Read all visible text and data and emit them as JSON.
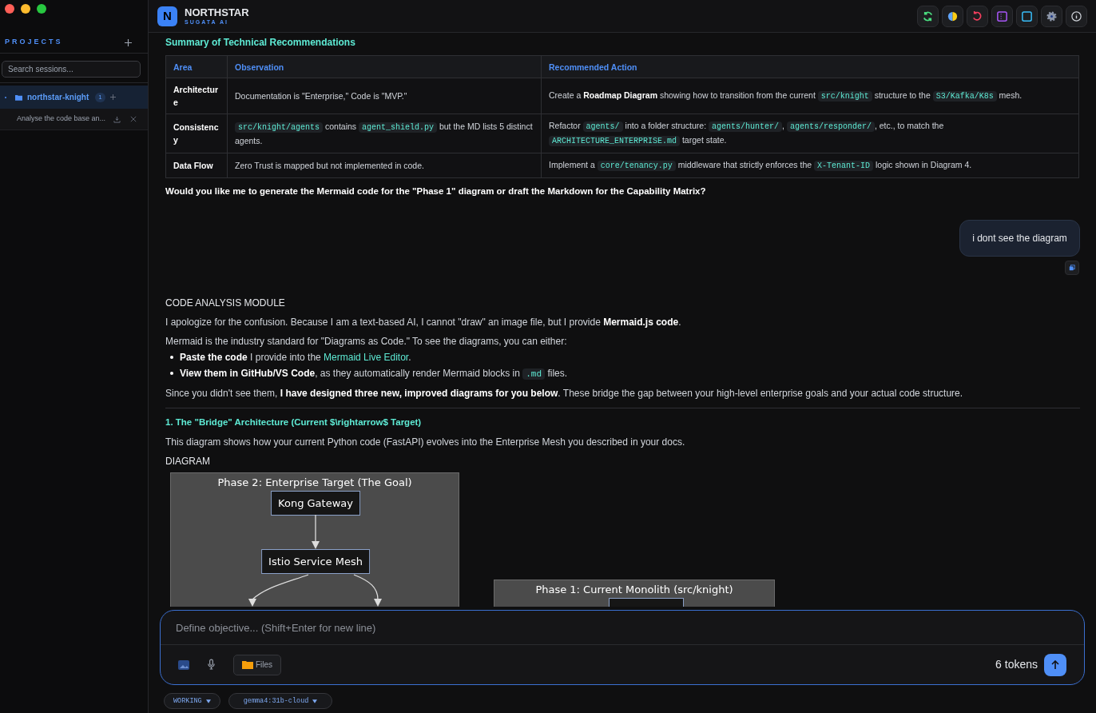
{
  "sidebar": {
    "section_title": "PROJECTS",
    "search": {
      "placeholder": "Search sessions..."
    },
    "projects": [
      {
        "name": "northstar-knight",
        "count": "1",
        "selected": true,
        "sessions": [
          {
            "title": "Analyse the code base an..."
          }
        ]
      }
    ]
  },
  "header": {
    "logo_letter": "N",
    "app_name": "NORTHSTAR",
    "subtitle": "SUGATA AI"
  },
  "summary": {
    "heading": "Summary of Technical Recommendations",
    "columns": [
      "Area",
      "Observation",
      "Recommended Action"
    ],
    "rows": [
      [
        [
          {
            "kind": "text",
            "text": "Architecture"
          }
        ],
        [
          {
            "kind": "text",
            "text": "Documentation is \"Enterprise,\" Code is \"MVP.\""
          }
        ],
        [
          {
            "kind": "text",
            "text": "Create a "
          },
          {
            "kind": "bold",
            "text": "Roadmap Diagram"
          },
          {
            "kind": "text",
            "text": " showing how to transition from the current "
          },
          {
            "kind": "code",
            "text": "src/knight"
          },
          {
            "kind": "text",
            "text": " structure to the "
          },
          {
            "kind": "code",
            "text": "S3/Kafka/K8s"
          },
          {
            "kind": "text",
            "text": " mesh."
          }
        ]
      ],
      [
        [
          {
            "kind": "text",
            "text": "Consistency"
          }
        ],
        [
          {
            "kind": "code",
            "text": "src/knight/agents"
          },
          {
            "kind": "text",
            "text": " contains "
          },
          {
            "kind": "code",
            "text": "agent_shield.py"
          },
          {
            "kind": "text",
            "text": " but the MD lists 5 distinct agents."
          }
        ],
        [
          {
            "kind": "text",
            "text": "Refactor "
          },
          {
            "kind": "code",
            "text": "agents/"
          },
          {
            "kind": "text",
            "text": " into a folder structure: "
          },
          {
            "kind": "code",
            "text": "agents/hunter/"
          },
          {
            "kind": "text",
            "text": ", "
          },
          {
            "kind": "code",
            "text": "agents/responder/"
          },
          {
            "kind": "text",
            "text": ", etc., to match the "
          },
          {
            "kind": "code",
            "text": "ARCHITECTURE_ENTERPRISE.md"
          },
          {
            "kind": "text",
            "text": " target state."
          }
        ]
      ],
      [
        [
          {
            "kind": "text",
            "text": "Data Flow"
          }
        ],
        [
          {
            "kind": "text",
            "text": "Zero Trust is mapped but not implemented in code."
          }
        ],
        [
          {
            "kind": "text",
            "text": "Implement a "
          },
          {
            "kind": "code",
            "text": "core/tenancy.py"
          },
          {
            "kind": "text",
            "text": " middleware that strictly enforces the "
          },
          {
            "kind": "code",
            "text": "X-Tenant-ID"
          },
          {
            "kind": "text",
            "text": " logic shown in Diagram 4."
          }
        ]
      ]
    ],
    "question": "Would you like me to generate the Mermaid code for the \"Phase 1\" diagram or draft the Markdown for the Capability Matrix?"
  },
  "user_message": {
    "text": "i dont see the diagram"
  },
  "reply": {
    "module_label": "CODE ANALYSIS MODULE",
    "blocks": [
      {
        "kind": "para",
        "segments": [
          {
            "kind": "text",
            "text": "I apologize for the confusion. Because I am a text-based AI, I cannot \"draw\" an image file, but I provide "
          },
          {
            "kind": "bold",
            "text": "Mermaid.js code"
          },
          {
            "kind": "text",
            "text": "."
          }
        ]
      },
      {
        "kind": "para",
        "segments": [
          {
            "kind": "text",
            "text": "Mermaid is the industry standard for \"Diagrams as Code.\" To see the diagrams, you can either:"
          }
        ]
      },
      {
        "kind": "bullet",
        "segments": [
          {
            "kind": "bold",
            "text": "Paste the code"
          },
          {
            "kind": "text",
            "text": " I provide into the "
          },
          {
            "kind": "link",
            "text": "Mermaid Live Editor"
          },
          {
            "kind": "text",
            "text": "."
          }
        ]
      },
      {
        "kind": "bullet",
        "segments": [
          {
            "kind": "bold",
            "text": "View them in GitHub/VS Code"
          },
          {
            "kind": "text",
            "text": ", as they automatically render Mermaid blocks in "
          },
          {
            "kind": "code",
            "text": ".md"
          },
          {
            "kind": "text",
            "text": " files."
          }
        ]
      },
      {
        "kind": "para",
        "segments": [
          {
            "kind": "text",
            "text": "Since you didn't see them, "
          },
          {
            "kind": "bold",
            "text": "I have designed three new, improved diagrams for you below"
          },
          {
            "kind": "text",
            "text": ". These bridge the gap between your high-level enterprise goals and your actual code structure."
          }
        ]
      },
      {
        "kind": "rule"
      },
      {
        "kind": "heading",
        "segments": [
          {
            "kind": "text",
            "text": "1. The \"Bridge\" Architecture (Current $\\rightarrow$ Target)"
          }
        ]
      },
      {
        "kind": "para",
        "segments": [
          {
            "kind": "text",
            "text": "This diagram shows how your current Python code (FastAPI) evolves into the Enterprise Mesh you described in your docs."
          }
        ]
      },
      {
        "kind": "label",
        "segments": [
          {
            "kind": "text",
            "text": "DIAGRAM"
          }
        ]
      }
    ],
    "diagram": {
      "panels": [
        {
          "title": "Phase 2: Enterprise Target (The Goal)",
          "nodes": [
            "Kong Gateway",
            "Istio Service Mesh"
          ]
        },
        {
          "title": "Phase 1: Current Monolith (src/knight)"
        }
      ]
    }
  },
  "composer": {
    "placeholder": "Define objective... (Shift+Enter for new line)",
    "files_label": "Files",
    "token_count": "6 tokens"
  },
  "status": {
    "mode": "WORKING",
    "model": "gemma4:31b-cloud"
  }
}
